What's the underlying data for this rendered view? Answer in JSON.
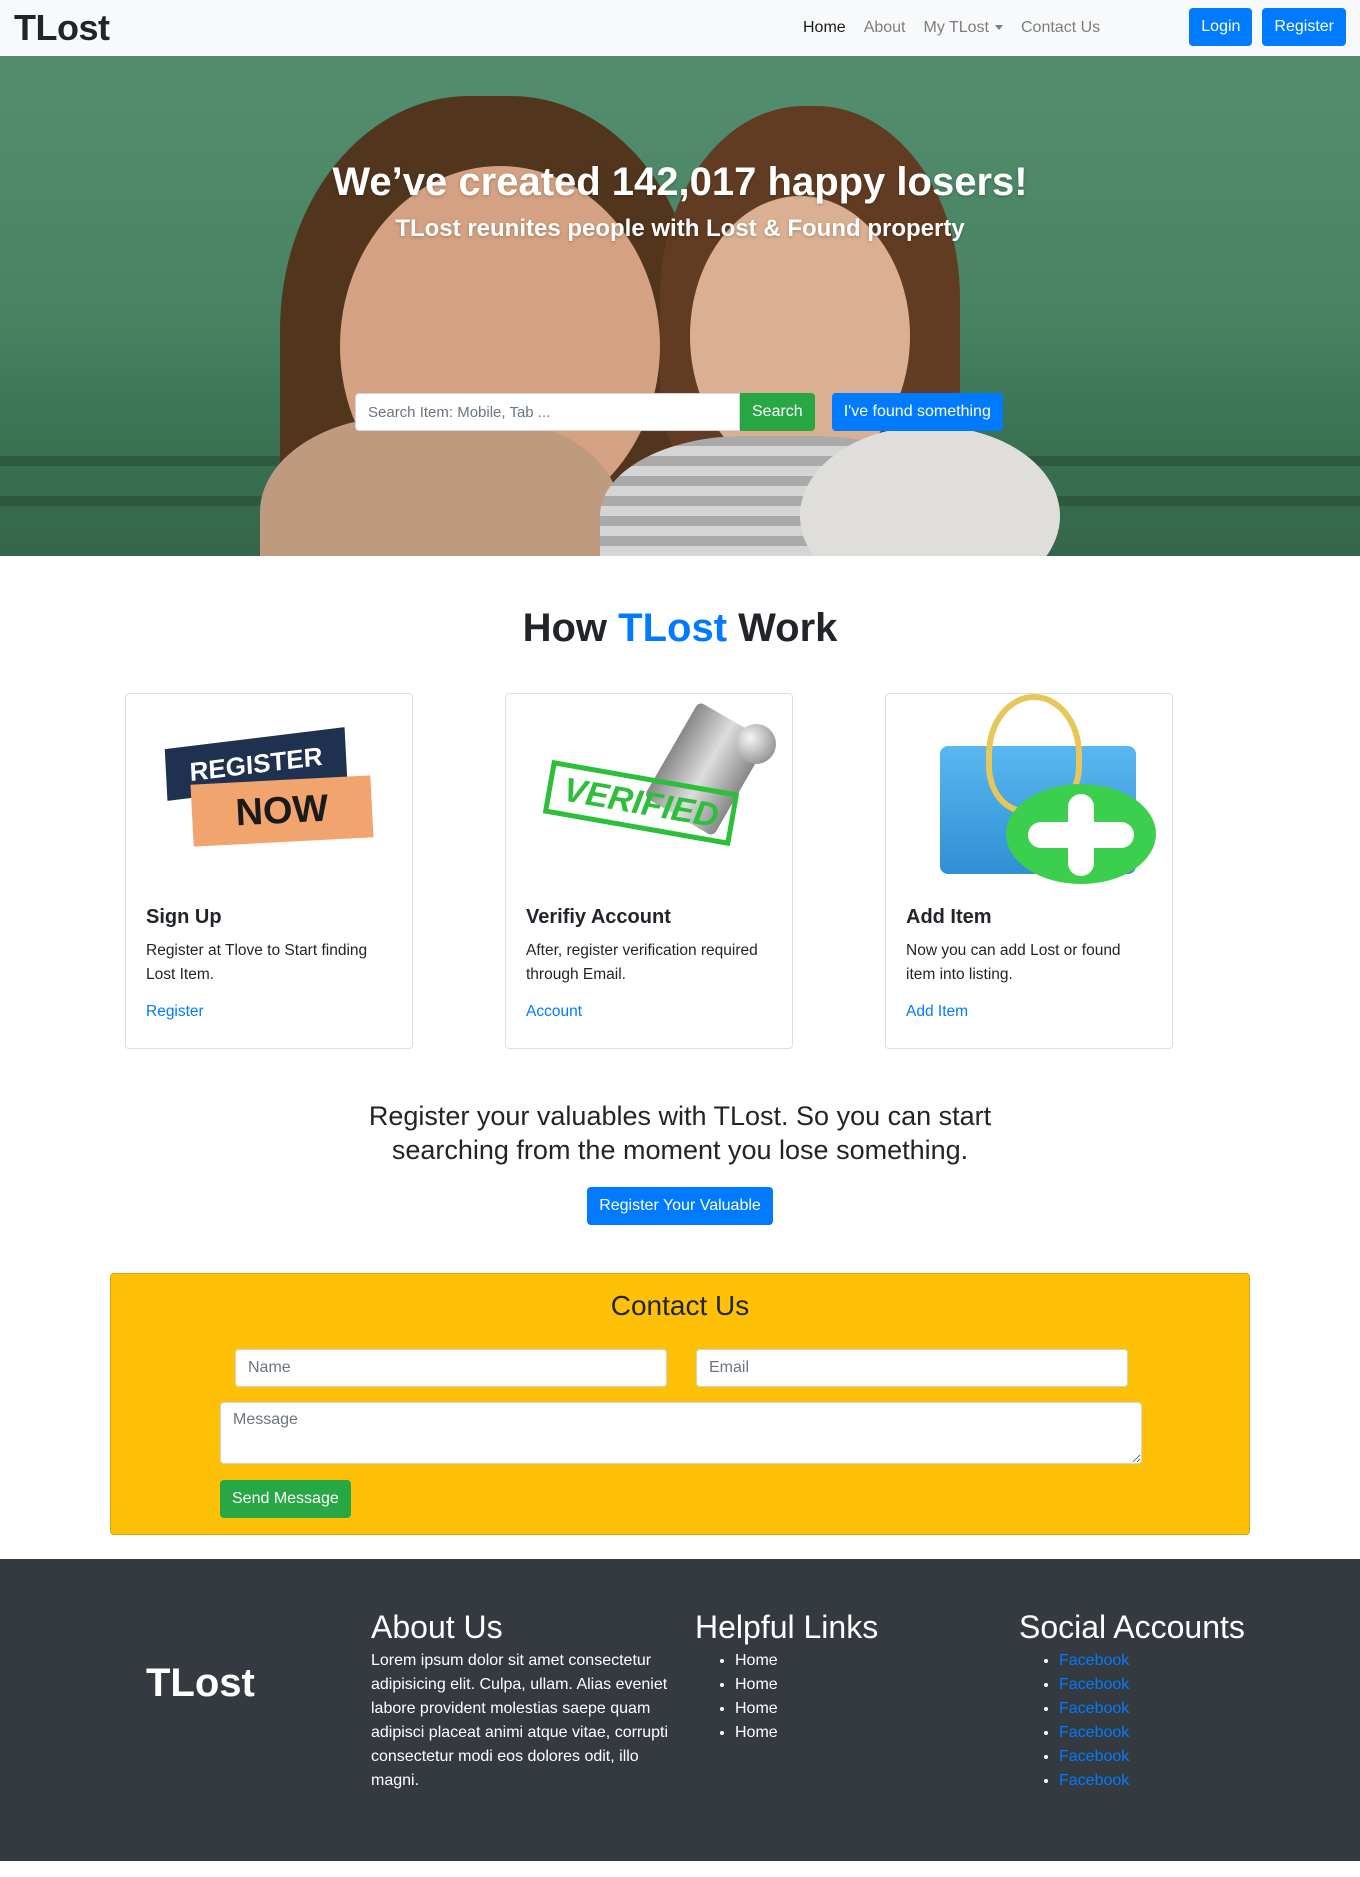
{
  "navbar": {
    "brand": "TLost",
    "links": [
      {
        "label": "Home"
      },
      {
        "label": "About"
      },
      {
        "label": "My TLost"
      },
      {
        "label": "Contact Us"
      }
    ],
    "login_label": "Login",
    "register_label": "Register"
  },
  "hero": {
    "title": "We’ve created 142,017 happy losers!",
    "subtitle": "TLost reunites people with Lost & Found property",
    "search_placeholder": "Search Item: Mobile, Tab ...",
    "search_button": "Search",
    "found_button": "I've found something"
  },
  "how": {
    "title_prefix": "How",
    "title_accent": "TLost",
    "title_suffix": "Work",
    "cards": [
      {
        "badge_top": "REGISTER",
        "badge_bottom": "NOW",
        "title": "Sign Up",
        "text": "Register at Tlove to Start finding Lost Item.",
        "link": "Register"
      },
      {
        "stamp_text": "VERIFIED",
        "title": "Verifiy Account",
        "text": "After, register verification required through Email.",
        "link": "Account"
      },
      {
        "title": "Add Item",
        "text": "Now you can add Lost or found item into listing.",
        "link": "Add Item"
      }
    ]
  },
  "cta": {
    "text": "Register your valuables with TLost. So you can start searching from the moment you lose something.",
    "button": "Register Your Valuable"
  },
  "contact": {
    "title": "Contact Us",
    "name_placeholder": "Name",
    "email_placeholder": "Email",
    "message_placeholder": "Message",
    "send_button": "Send Message"
  },
  "footer": {
    "brand": "TLost",
    "about_title": "About Us",
    "about_text": "Lorem ipsum dolor sit amet consectetur adipisicing elit. Culpa, ullam. Alias eveniet labore provident molestias saepe quam adipisci placeat animi atque vitae, corrupti consectetur modi eos dolores odit, illo magni.",
    "links_title": "Helpful Links",
    "links": [
      "Home",
      "Home",
      "Home",
      "Home"
    ],
    "social_title": "Social Accounts",
    "social": [
      "Facebook",
      "Facebook",
      "Facebook",
      "Facebook",
      "Facebook",
      "Facebook"
    ]
  },
  "colors": {
    "primary": "#007bff",
    "success": "#28a745",
    "warning": "#ffc107",
    "dark": "#343a40"
  }
}
